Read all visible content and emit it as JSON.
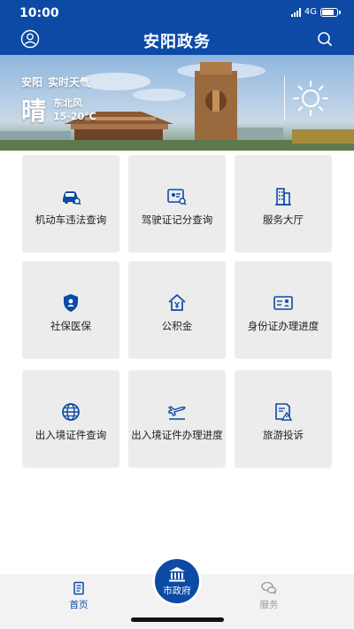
{
  "status_bar": {
    "time": "10:00",
    "network": "4G"
  },
  "header": {
    "title": "安阳政务",
    "left_icon": "user-icon",
    "right_icon": "search-icon"
  },
  "weather": {
    "city": "安阳",
    "label": "实时天气",
    "condition": "晴",
    "wind": "东北风",
    "temperature": "15-20℃",
    "icon": "sun-icon"
  },
  "services": [
    {
      "label": "机动车违法查询",
      "icon": "car-search-icon"
    },
    {
      "label": "驾驶证记分查询",
      "icon": "license-search-icon"
    },
    {
      "label": "服务大厅",
      "icon": "building-icon"
    },
    {
      "label": "社保医保",
      "icon": "shield-user-icon"
    },
    {
      "label": "公积金",
      "icon": "house-yen-icon"
    },
    {
      "label": "身份证办理进度",
      "icon": "id-card-icon"
    },
    {
      "label": "出入境证件查询",
      "icon": "globe-icon"
    },
    {
      "label": "出入境证件办理进度",
      "icon": "plane-icon"
    },
    {
      "label": "旅游投诉",
      "icon": "complaint-icon"
    }
  ],
  "bottom_nav": {
    "home": {
      "label": "首页",
      "icon": "document-icon"
    },
    "center": {
      "label": "市政府",
      "icon": "government-building-icon"
    },
    "service": {
      "label": "服务",
      "icon": "chat-icon"
    }
  },
  "colors": {
    "primary": "#0c4aa5",
    "tile": "#ececec",
    "inactive": "#9a9a9a"
  }
}
